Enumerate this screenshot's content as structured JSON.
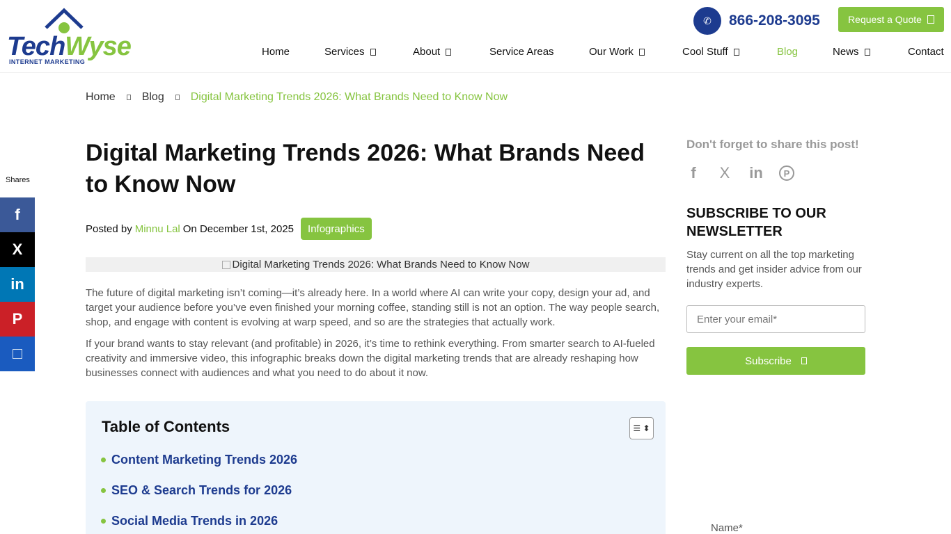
{
  "header": {
    "logo": {
      "word_a": "Tech",
      "word_b": "Wyse",
      "tagline": "INTERNET MARKETING"
    },
    "phone": "866-208-3095",
    "quote_label": "Request a Quote"
  },
  "nav": {
    "items": [
      {
        "label": "Home"
      },
      {
        "label": "Services"
      },
      {
        "label": "About"
      },
      {
        "label": "Service Areas"
      },
      {
        "label": "Our Work"
      },
      {
        "label": "Cool Stuff"
      },
      {
        "label": "Blog"
      },
      {
        "label": "News"
      },
      {
        "label": "Contact"
      }
    ]
  },
  "side_share": {
    "label": "Shares",
    "facebook": "f",
    "x": "X",
    "linkedin": "in",
    "pinterest": "P"
  },
  "breadcrumb": {
    "home": "Home",
    "blog": "Blog",
    "current": "Digital Marketing Trends 2026: What Brands Need to Know Now"
  },
  "article": {
    "title": "Digital Marketing Trends 2026: What Brands Need to Know Now",
    "posted_by": "Posted by",
    "author": "Minnu Lal",
    "on": "On December 1st, 2025",
    "tag": "Infographics",
    "image_alt": "Digital Marketing Trends 2026: What Brands Need to Know Now",
    "p1": "The future of digital marketing isn’t coming—it’s already here. In a world where AI can write your copy, design your ad, and target your audience before you’ve even finished your morning coffee, standing still is not an option. The way people search, shop, and engage with content is evolving at warp speed, and so are the strategies that actually work.",
    "p2": "If your brand wants to stay relevant (and profitable) in 2026, it’s time to rethink everything. From smarter search to AI-fueled creativity and immersive video, this infographic breaks down the digital marketing trends that are already reshaping how businesses connect with audiences and what you need to do about it now."
  },
  "toc": {
    "title": "Table of Contents",
    "items": [
      "Content Marketing Trends 2026",
      "SEO & Search Trends for 2026",
      "Social Media Trends in 2026"
    ]
  },
  "sidebar": {
    "share_head": "Don't forget to share this post!",
    "icons": {
      "facebook": "f",
      "x": "X",
      "linkedin": "in",
      "pinterest": "P"
    },
    "sub_head": "SUBSCRIBE TO OUR NEWSLETTER",
    "sub_text": "Stay current on all the top marketing trends and get insider advice from our industry experts.",
    "email_placeholder": "Enter your email*",
    "subscribe_label": "Subscribe",
    "name_label": "Name*"
  },
  "colors": {
    "brand_blue": "#1d3b8f",
    "brand_green": "#86c440"
  }
}
